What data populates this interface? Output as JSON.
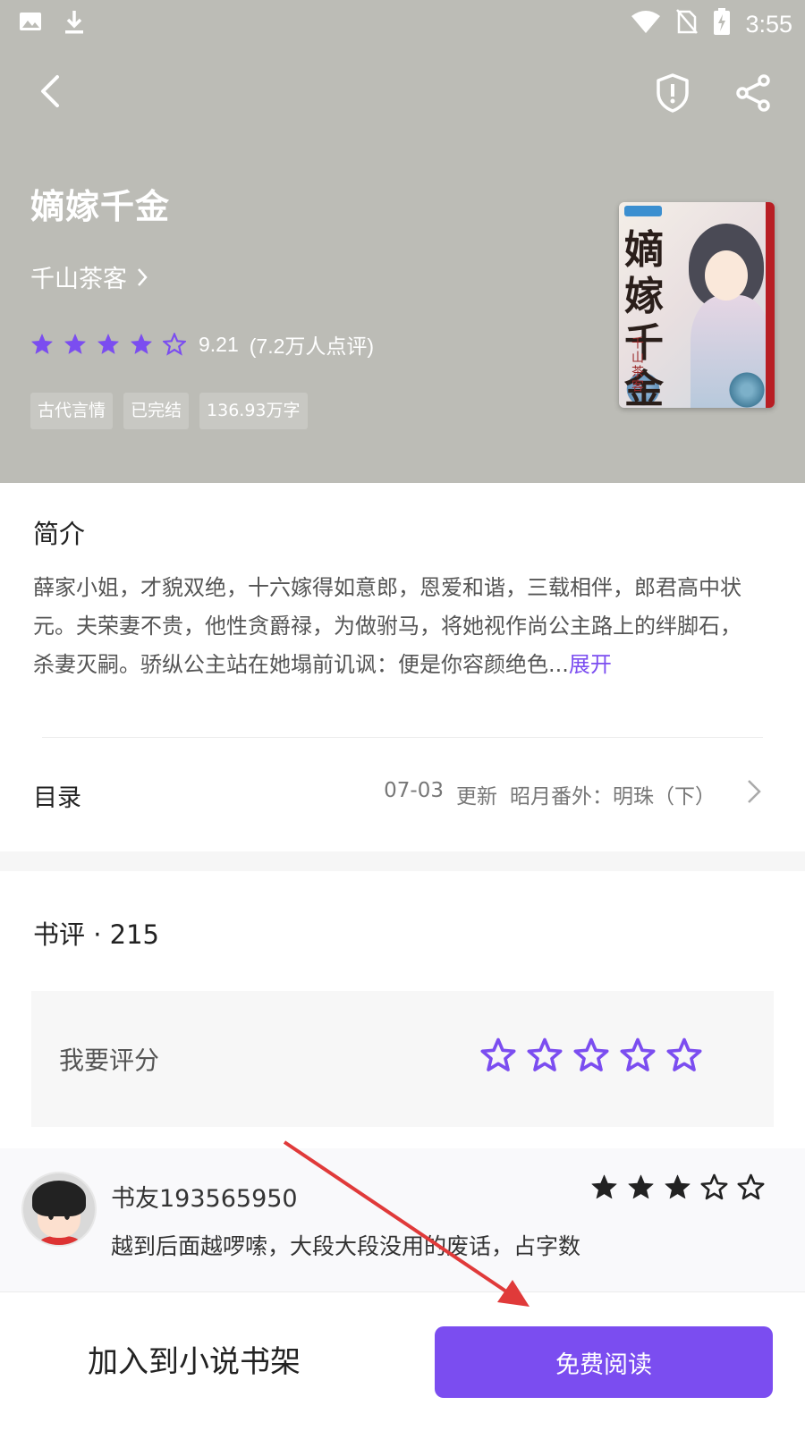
{
  "status_bar": {
    "time": "3:55",
    "icons": [
      "image-icon",
      "download-icon",
      "wifi-icon",
      "no-sim-icon",
      "battery-charging-icon"
    ]
  },
  "toolbar": {
    "back_icon": "back-arrow-icon",
    "report_icon": "shield-alert-icon",
    "share_icon": "share-icon"
  },
  "book": {
    "title": "嫡嫁千金",
    "author": "千山茶客",
    "rating": "9.21",
    "rating_count": "(7.2万人点评)",
    "rating_stars": 4.5,
    "tags": [
      "古代言情",
      "已完结",
      "136.93万字"
    ],
    "cover": {
      "title": "嫡嫁千金",
      "author": "千山茶客"
    }
  },
  "intro": {
    "title": "简介",
    "text": "薛家小姐，才貌双绝，十六嫁得如意郎，恩爱和谐，三载相伴，郎君高中状元。夫荣妻不贵，他性贪爵禄，为做驸马，将她视作尚公主路上的绊脚石，杀妻灭嗣。骄纵公主站在她塌前讥讽：便是你容颜绝色...",
    "more": "展开"
  },
  "toc": {
    "label": "目录",
    "date": "07-03",
    "update": "更新",
    "latest_chapter": "昭月番外：明珠（下）"
  },
  "reviews": {
    "title": "书评 · 215",
    "rate_prompt": "我要评分",
    "items": [
      {
        "name": "书友193565950",
        "stars": 3,
        "text": "越到后面越啰嗦，大段大段没用的废话，占字数"
      }
    ]
  },
  "bottom_bar": {
    "add_to_shelf": "加入到小说书架",
    "read_free": "免费阅读"
  },
  "colors": {
    "accent": "#7b4df0",
    "header_bg": "#bcbcb6",
    "annotation_arrow": "#e03a3a"
  }
}
